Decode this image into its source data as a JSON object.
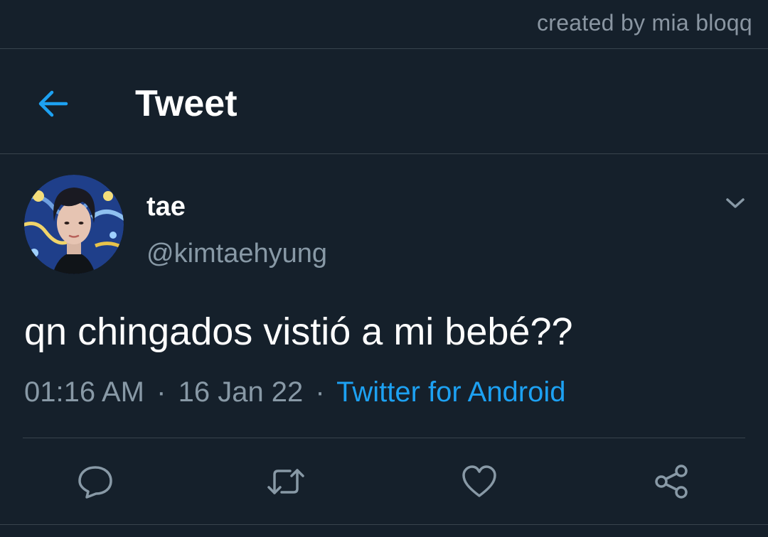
{
  "watermark": "created by mia bloqq",
  "header": {
    "back_icon": "arrow-left-icon",
    "title": "Tweet"
  },
  "tweet": {
    "display_name": "tae",
    "handle": "@kimtaehyung",
    "text": "qn chingados vistió a mi bebé??",
    "time": "01:16 AM",
    "date": "16 Jan 22",
    "separator": "·",
    "source": "Twitter for Android"
  },
  "actions": {
    "reply_icon": "reply-icon",
    "retweet_icon": "retweet-icon",
    "like_icon": "heart-icon",
    "share_icon": "share-icon"
  },
  "colors": {
    "background": "#15202b",
    "accent": "#1da1f2",
    "secondary_text": "#8899a6",
    "divider": "#38444d"
  }
}
